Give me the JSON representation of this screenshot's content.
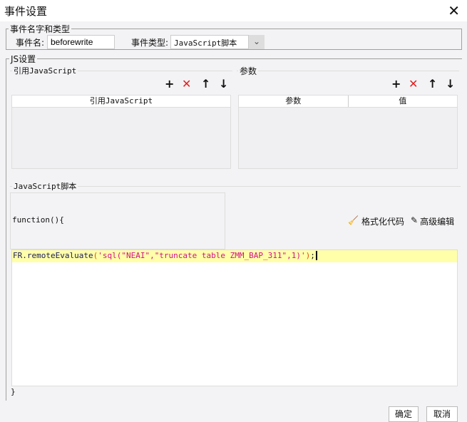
{
  "dialog": {
    "title": "事件设置",
    "close": "✕"
  },
  "name_group": {
    "label": "事件名字和类型",
    "name_label": "事件名:",
    "name_value": "beforewrite",
    "type_label": "事件类型:",
    "type_value": "JavaScript脚本"
  },
  "js_group": {
    "label": "JS设置"
  },
  "ref_js": {
    "label": "引用JavaScript",
    "column": "引用JavaScript",
    "toolbar": {
      "add": "+",
      "delete": "✕",
      "up": "↑",
      "down": "↓"
    }
  },
  "params": {
    "label": "参数",
    "columns": [
      "参数",
      "值"
    ],
    "toolbar": {
      "add": "+",
      "delete": "✕",
      "up": "↑",
      "down": "↓"
    }
  },
  "script": {
    "label": "JavaScript脚本",
    "header": "function(){",
    "format_label": "格式化代码",
    "advanced_label": "高级编辑",
    "code": {
      "obj": "FR.remoteEvaluate",
      "open": "(",
      "str": "'sql(\"NEAI\",\"truncate table ZMM_BAP_311\",1)'",
      "close": ")",
      "end": ";"
    },
    "footer": "}"
  },
  "buttons": {
    "ok": "确定",
    "cancel": "取消"
  }
}
